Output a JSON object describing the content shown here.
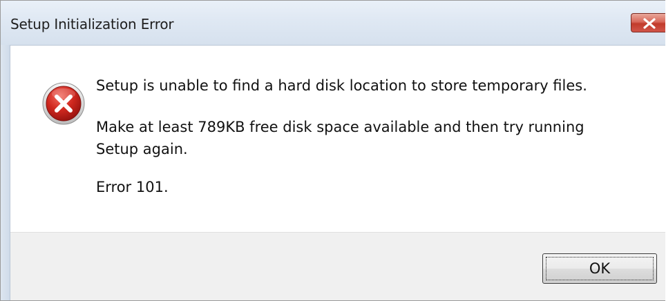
{
  "window": {
    "title": "Setup Initialization Error",
    "close_icon": "close-x-icon",
    "close_color": "#c13b2b"
  },
  "dialog": {
    "icon": "error-icon",
    "icon_color": "#c8211b",
    "message_line1": "Setup is unable to find a hard disk location to store temporary files.",
    "message_line2": "Make at least 789KB free disk space available and then try running Setup again.",
    "message_line3": "Error 101."
  },
  "buttons": {
    "ok_label": "OK"
  }
}
